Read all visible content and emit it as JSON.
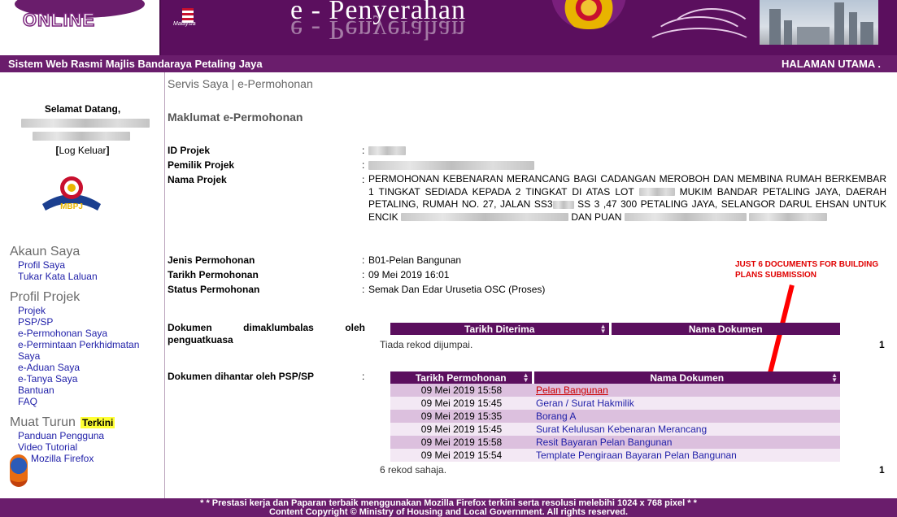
{
  "header": {
    "logo_text": "ONLINE",
    "flag_caption": "Malaysia",
    "banner_title": "e - Penyerahan",
    "site_name": "Sistem Web Rasmi Majlis Bandaraya Petaling Jaya",
    "home_link": "HALAMAN UTAMA ."
  },
  "sidebar": {
    "welcome": "Selamat Datang,",
    "logout_open": "[",
    "logout_label": "Log Keluar",
    "logout_close": "]",
    "badge_text": "MBPJ",
    "akaun": {
      "heading": "Akaun Saya",
      "items": [
        "Profil Saya",
        "Tukar Kata Laluan"
      ]
    },
    "profil": {
      "heading": "Profil Projek",
      "items": [
        "Projek",
        "PSP/SP",
        "e-Permohonan Saya",
        "e-Permintaan Perkhidmatan",
        "Saya",
        "e-Aduan Saya",
        "e-Tanya Saya",
        "Bantuan",
        "FAQ"
      ]
    },
    "muat": {
      "heading": "Muat Turun",
      "badge": "Terkini",
      "items": [
        "Panduan Pengguna",
        "Video Tutorial",
        "Mozilla Firefox"
      ]
    }
  },
  "main": {
    "breadcrumb": "Servis Saya | e-Permohonan",
    "section_title": "Maklumat e-Permohonan",
    "colon": ":",
    "labels": {
      "id": "ID Projek",
      "pemilik": "Pemilik Projek",
      "nama": "Nama Projek",
      "jenis": "Jenis Permohonan",
      "tarikh": "Tarikh Permohonan",
      "status": "Status Permohonan"
    },
    "nama_parts": {
      "p1": "PERMOHONAN KEBENARAN MERANCANG BAGI CADANGAN MEROBOH DAN MEMBINA RUMAH BERKEMBAR 1 TINGKAT SEDIADA KEPADA 2 TINGKAT DI ATAS LOT",
      "p2": "MUKIM BANDAR PETALING JAYA, DAERAH PETALING, RUMAH NO. 27, JALAN SS3",
      "p3": "SS 3 ,47 300 PETALING JAYA, SELANGOR DARUL EHSAN UNTUK ENCIK",
      "p4": "DAN PUAN"
    },
    "values": {
      "jenis": "B01-Pelan Bangunan",
      "tarikh": "09 Mei 2019 16:01",
      "status": "Semak Dan Edar Urusetia OSC (Proses)"
    },
    "annotation": "JUST 6 DOCUMENTS FOR BUILDING PLANS SUBMISSION",
    "dokumen_penguatkuasa": {
      "label_a": "Dokumen",
      "label_b": "dimaklumbalas",
      "label_c": "oleh",
      "label_line2": "penguatkuasa",
      "col_date": "Tarikh Diterima",
      "col_name": "Nama Dokumen",
      "empty": "Tiada rekod dijumpai.",
      "page": "1"
    },
    "dokumen_psp": {
      "label": "Dokumen dihantar oleh PSP/SP",
      "col_date": "Tarikh Permohonan",
      "col_name": "Nama Dokumen",
      "rows": [
        {
          "date": "09 Mei 2019 15:58",
          "name": "Pelan Bangunan"
        },
        {
          "date": "09 Mei 2019 15:45",
          "name": "Geran / Surat Hakmilik"
        },
        {
          "date": "09 Mei 2019 15:35",
          "name": "Borang A"
        },
        {
          "date": "09 Mei 2019 15:45",
          "name": "Surat Kelulusan Kebenaran Merancang"
        },
        {
          "date": "09 Mei 2019 15:58",
          "name": "Resit Bayaran Pelan Bangunan"
        },
        {
          "date": "09 Mei 2019 15:54",
          "name": "Template Pengiraan Bayaran Pelan Bangunan"
        }
      ],
      "summary": "6 rekod sahaja.",
      "page": "1"
    }
  },
  "footer": {
    "line1": "* * Prestasi kerja dan Paparan terbaik menggunakan Mozilla Firefox terkini serta resolusi melebihi 1024 x 768 pixel * *",
    "line2": "Content Copyright © Ministry of Housing and Local Government. All rights reserved."
  },
  "colors": {
    "brand_purple": "#5b0f5e",
    "row_odd": "#dcc0de",
    "row_even": "#f3e8f4",
    "link_blue": "#1e1ea8",
    "annotation_red": "#ff0000",
    "highlight_yellow": "#ffff33"
  }
}
